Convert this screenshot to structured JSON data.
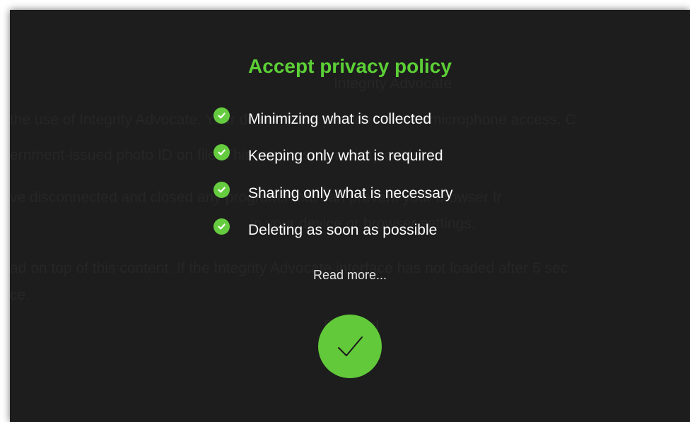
{
  "dialog": {
    "title": "Accept privacy policy",
    "items": [
      {
        "label": "Minimizing what is collected",
        "icon": "check-circle-icon"
      },
      {
        "label": "Keeping only what is required",
        "icon": "check-circle-icon"
      },
      {
        "label": "Sharing only what is necessary",
        "icon": "check-circle-icon"
      },
      {
        "label": "Deleting as soon as possible",
        "icon": "check-circle-icon"
      }
    ],
    "read_more": "Read more...",
    "accept_icon": "checkmark-icon"
  },
  "background": {
    "lines": [
      "Integrity Advocate",
      "the use of Integrity Advocate. Your device must provide camera/microphone access. C",
      "ernment-issued photo ID on file. This requires no activity content.",
      "ve disconnected and closed any programs that can prevent your browser fr",
      "in your device or browser settings.",
      "ad on top of this content. If the Integrity Advocate interface has not loaded after 5 sec",
      "ce.",
      "Proceed"
    ]
  },
  "colors": {
    "accent": "#5ccf36",
    "check": "#66cc3f",
    "panel": "#1d1d1d"
  }
}
